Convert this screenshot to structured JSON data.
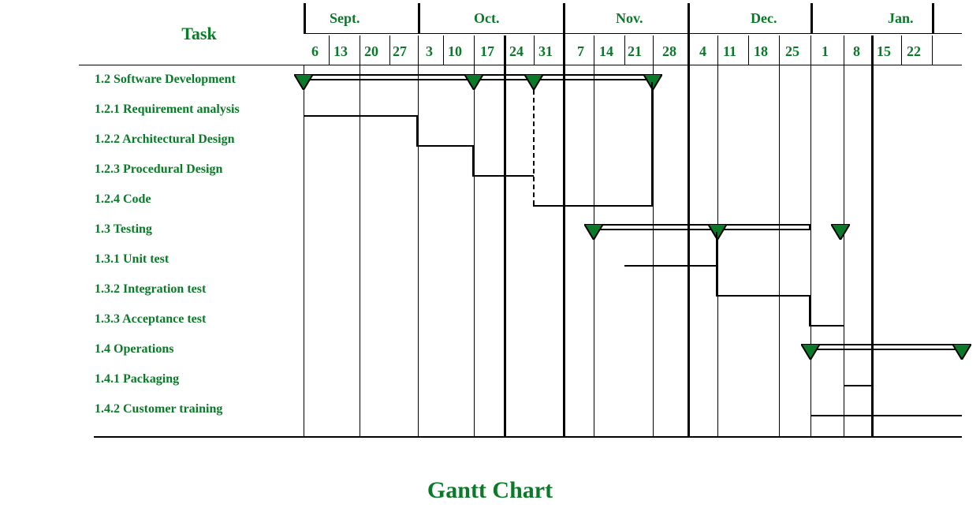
{
  "chart_data": {
    "type": "gantt",
    "title": "Gantt Chart",
    "task_header": "Task",
    "months": [
      "Sept.",
      "Oct.",
      "Nov.",
      "Dec.",
      "Jan."
    ],
    "days": [
      "6",
      "13",
      "20",
      "27",
      "3",
      "10",
      "17",
      "24",
      "31",
      "7",
      "14",
      "21",
      "28",
      "4",
      "11",
      "18",
      "25",
      "1",
      "8",
      "15",
      "22"
    ],
    "tasks": [
      {
        "id": "1.2",
        "name": "Software Development",
        "summary": true,
        "start": 0,
        "end": 11,
        "milestones": [
          0,
          5,
          8,
          11
        ]
      },
      {
        "id": "1.2.1",
        "name": "Requirement analysis",
        "start": 0,
        "end": 3
      },
      {
        "id": "1.2.2",
        "name": "Architectural Design",
        "start": 3,
        "end": 5
      },
      {
        "id": "1.2.3",
        "name": "Procedural Design",
        "start": 5,
        "end": 8,
        "dashedLinkTo": "1.2.4"
      },
      {
        "id": "1.2.4",
        "name": "Code",
        "start": 8,
        "end": 11
      },
      {
        "id": "1.3",
        "name": "Testing",
        "summary": true,
        "start": 9,
        "end": 16,
        "milestones": [
          9,
          12,
          16
        ]
      },
      {
        "id": "1.3.1",
        "name": "Unit test",
        "start": 10,
        "end": 12
      },
      {
        "id": "1.3.2",
        "name": "Integration test",
        "start": 12,
        "end": 16
      },
      {
        "id": "1.3.3",
        "name": "Acceptance test",
        "start": 16,
        "end": 17
      },
      {
        "id": "1.4",
        "name": "Operations",
        "summary": true,
        "start": 16,
        "end": 21,
        "milestones": [
          16,
          21
        ]
      },
      {
        "id": "1.4.1",
        "name": "Packaging",
        "start": 17,
        "end": 18
      },
      {
        "id": "1.4.2",
        "name": "Customer training",
        "start": 16,
        "end": 21
      }
    ]
  }
}
